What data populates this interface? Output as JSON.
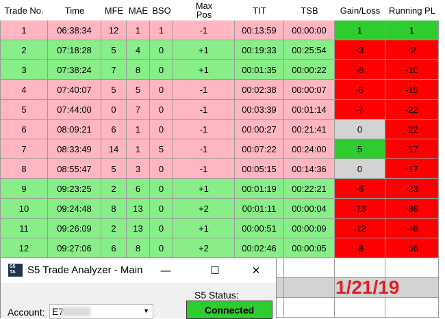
{
  "colors": {
    "row_long": "#88ee88",
    "row_short": "#ffb6c1",
    "gain_pos": "#2ecc2e",
    "gain_neg": "#ff0000",
    "gain_zero": "#d3d3d3",
    "header_bg": "#ffffff",
    "summary_bg": "#d3d3d3",
    "date_text": "#e02020"
  },
  "table": {
    "columns": [
      {
        "key": "trade_no",
        "label": "Trade No."
      },
      {
        "key": "time",
        "label": "Time"
      },
      {
        "key": "mfe",
        "label": "MFE"
      },
      {
        "key": "mae",
        "label": "MAE"
      },
      {
        "key": "bso",
        "label": "BSO"
      },
      {
        "key": "max_pos",
        "label": "Max\nPos"
      },
      {
        "key": "tit",
        "label": "TIT"
      },
      {
        "key": "tsb",
        "label": "TSB"
      },
      {
        "key": "gain_loss",
        "label": "Gain/Loss"
      },
      {
        "key": "running_pl",
        "label": "Running PL"
      }
    ],
    "rows": [
      {
        "trade_no": "1",
        "time": "06:38:34",
        "mfe": "12",
        "mae": "1",
        "bso": "1",
        "max_pos": "-1",
        "tit": "00:13:59",
        "tsb": "00:00:00",
        "gain_loss": "1",
        "running_pl": "1"
      },
      {
        "trade_no": "2",
        "time": "07:18:28",
        "mfe": "5",
        "mae": "4",
        "bso": "0",
        "max_pos": "+1",
        "tit": "00:19:33",
        "tsb": "00:25:54",
        "gain_loss": "-3",
        "running_pl": "-2"
      },
      {
        "trade_no": "3",
        "time": "07:38:24",
        "mfe": "7",
        "mae": "8",
        "bso": "0",
        "max_pos": "+1",
        "tit": "00:01:35",
        "tsb": "00:00:22",
        "gain_loss": "-8",
        "running_pl": "-10"
      },
      {
        "trade_no": "4",
        "time": "07:40:07",
        "mfe": "5",
        "mae": "5",
        "bso": "0",
        "max_pos": "-1",
        "tit": "00:02:38",
        "tsb": "00:00:07",
        "gain_loss": "-5",
        "running_pl": "-15"
      },
      {
        "trade_no": "5",
        "time": "07:44:00",
        "mfe": "0",
        "mae": "7",
        "bso": "0",
        "max_pos": "-1",
        "tit": "00:03:39",
        "tsb": "00:01:14",
        "gain_loss": "-7",
        "running_pl": "-22"
      },
      {
        "trade_no": "6",
        "time": "08:09:21",
        "mfe": "6",
        "mae": "1",
        "bso": "0",
        "max_pos": "-1",
        "tit": "00:00:27",
        "tsb": "00:21:41",
        "gain_loss": "0",
        "running_pl": "-22"
      },
      {
        "trade_no": "7",
        "time": "08:33:49",
        "mfe": "14",
        "mae": "1",
        "bso": "5",
        "max_pos": "-1",
        "tit": "00:07:22",
        "tsb": "00:24:00",
        "gain_loss": "5",
        "running_pl": "-17"
      },
      {
        "trade_no": "8",
        "time": "08:55:47",
        "mfe": "5",
        "mae": "3",
        "bso": "0",
        "max_pos": "-1",
        "tit": "00:05:15",
        "tsb": "00:14:36",
        "gain_loss": "0",
        "running_pl": "-17"
      },
      {
        "trade_no": "9",
        "time": "09:23:25",
        "mfe": "2",
        "mae": "6",
        "bso": "0",
        "max_pos": "+1",
        "tit": "00:01:19",
        "tsb": "00:22:21",
        "gain_loss": "-6",
        "running_pl": "-23"
      },
      {
        "trade_no": "10",
        "time": "09:24:48",
        "mfe": "8",
        "mae": "13",
        "bso": "0",
        "max_pos": "+2",
        "tit": "00:01:11",
        "tsb": "00:00:04",
        "gain_loss": "-13",
        "running_pl": "-36"
      },
      {
        "trade_no": "11",
        "time": "09:26:09",
        "mfe": "2",
        "mae": "13",
        "bso": "0",
        "max_pos": "+1",
        "tit": "00:00:51",
        "tsb": "00:00:09",
        "gain_loss": "-12",
        "running_pl": "-48"
      },
      {
        "trade_no": "12",
        "time": "09:27:06",
        "mfe": "6",
        "mae": "8",
        "bso": "0",
        "max_pos": "+2",
        "tit": "00:02:46",
        "tsb": "00:00:05",
        "gain_loss": "-8",
        "running_pl": "-56"
      }
    ],
    "summary_date": "1/21/19"
  },
  "window": {
    "logo_text": "S5\nTA",
    "title": "S5 Trade Analyzer - Main",
    "minimize_glyph": "—",
    "maximize_glyph": "☐",
    "close_glyph": "✕",
    "account_label": "Account:",
    "account_value": "E7",
    "status_label": "S5 Status:",
    "status_value": "Connected",
    "status_color": "#2ecc2e"
  }
}
